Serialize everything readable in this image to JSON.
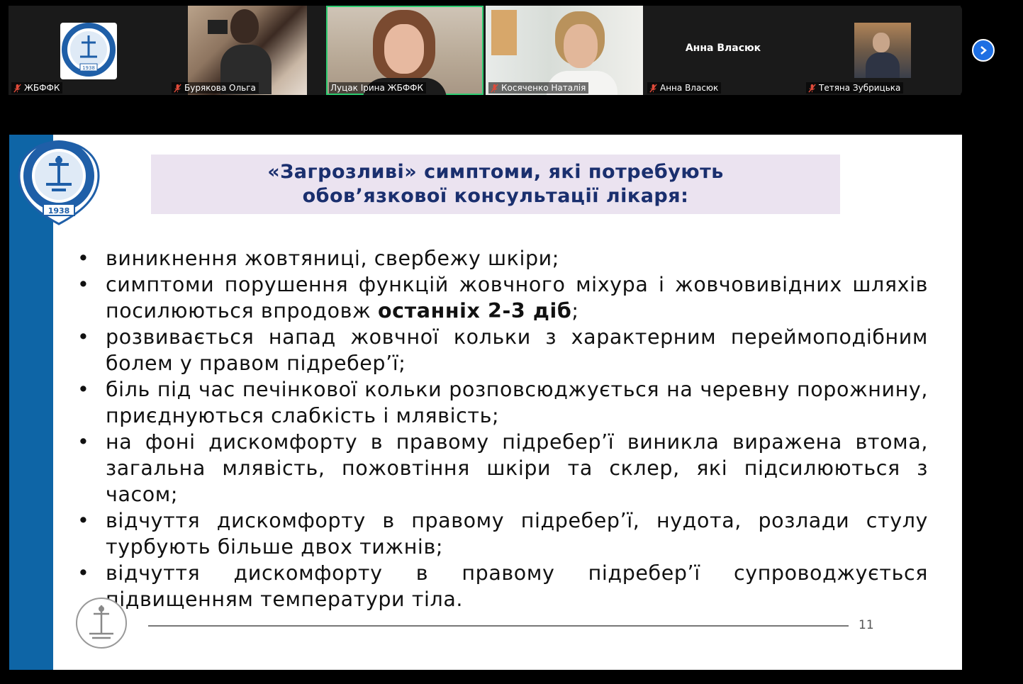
{
  "participants": [
    {
      "name": "ЖБФФК",
      "muted": true,
      "type": "logo"
    },
    {
      "name": "Бурякова Ольга",
      "muted": true,
      "type": "video"
    },
    {
      "name": "Луцак Ірина ЖБФФК",
      "muted": false,
      "type": "video",
      "active": true
    },
    {
      "name": "Косяченко Наталія",
      "muted": true,
      "type": "video"
    },
    {
      "name": "Анна Власюк",
      "muted": true,
      "type": "text",
      "display": "Анна Власюк"
    },
    {
      "name": "Тетяна Зубрицька",
      "muted": true,
      "type": "video"
    }
  ],
  "logo": {
    "year": "1938"
  },
  "slide": {
    "title_line1": "«Загрозливі» симптоми, які потребують",
    "title_line2": "обов’язкової консультації лікаря:",
    "bullets": [
      {
        "text": "виникнення жовтяниці, свербежу шкіри;"
      },
      {
        "pre": "симптоми порушення функцій жовчного міхура і жовчовивідних шляхів посилюються впродовж ",
        "bold": "останніх 2-3 діб",
        "post": ";"
      },
      {
        "text": "розвивається напад жовчної кольки з характерним переймоподібним болем у правом підребер’ї;"
      },
      {
        "text": "біль під час печінкової кольки розповсюджується на черевну порожнину, приєднуються слабкість і млявість;"
      },
      {
        "text": "на фоні дискомфорту в правому підребер’ї виникла виражена втома, загальна млявість, пожовтіння шкіри та склер, які підсилюються з часом;"
      },
      {
        "text": "відчуття дискомфорту в правому підребер’ї, нудота, розлади стулу турбують більше двох тижнів;"
      },
      {
        "text": "відчуття дискомфорту в правому підребер’ї супроводжується підвищенням температури тіла."
      }
    ],
    "page_number": "11"
  },
  "colors": {
    "accent_blue": "#0e65a6",
    "title_bg": "#ebe3f0",
    "title_text": "#1a2f6e",
    "active_border": "#2ecc71",
    "next_button": "#1e6fe3"
  },
  "icons": {
    "mute": "microphone-muted-icon",
    "next": "chevron-right-icon"
  }
}
